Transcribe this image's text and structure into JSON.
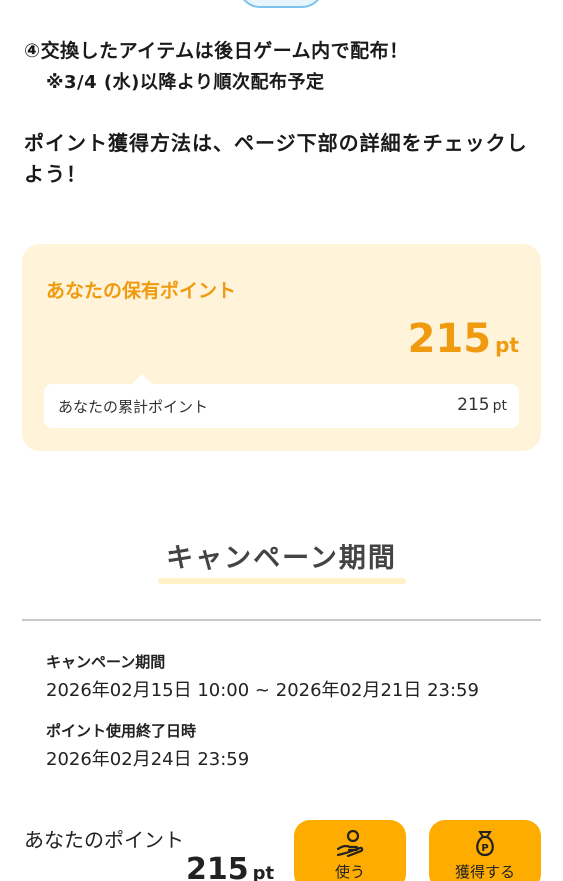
{
  "steps": {
    "step4": "④交換したアイテムは後日ゲーム内で配布！",
    "step4_note": "※3/4 (水)以降より順次配布予定"
  },
  "howto": "ポイント獲得方法は、ページ下部の詳細をチェックしよう！",
  "points_card": {
    "holding_label": "あなたの保有ポイント",
    "holding_value": "215",
    "unit": "pt",
    "cumulative_label": "あなたの累計ポイント",
    "cumulative_value": "215"
  },
  "campaign": {
    "section_title": "キャンペーン期間",
    "period_label": "キャンペーン期間",
    "period_value": "2026年02月15日 10:00 ~ 2026年02月21日 23:59",
    "end_label": "ポイント使用終了日時",
    "end_value": "2026年02月24日 23:59"
  },
  "footer": {
    "label": "あなたのポイント",
    "points": "215",
    "unit": "pt",
    "use_button": "使う",
    "earn_button": "獲得する"
  },
  "colors": {
    "accent": "#f09a10",
    "button": "#ffac00",
    "card_bg": "#fff4d9"
  },
  "icons": {
    "use": "hand-coin-icon",
    "earn": "coin-bag-icon"
  }
}
